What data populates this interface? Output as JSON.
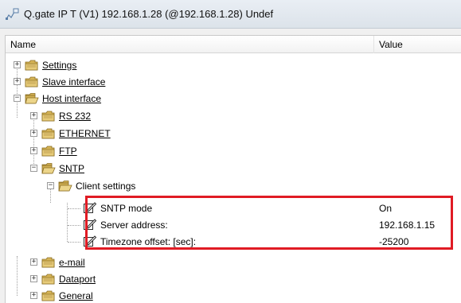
{
  "window": {
    "title": "Q.gate IP T (V1) 192.168.1.28 (@192.168.1.28) Undef"
  },
  "header": {
    "name": "Name",
    "value": "Value"
  },
  "tree": {
    "settings": "Settings",
    "slave_interface": "Slave interface",
    "host_interface": "Host interface",
    "rs232": "RS 232",
    "ethernet": "ETHERNET",
    "ftp": "FTP",
    "sntp": "SNTP",
    "client_settings": "Client settings",
    "sntp_mode": {
      "label": "SNTP mode",
      "value": "On"
    },
    "server_address": {
      "label": "Server address:",
      "value": "192.168.1.15"
    },
    "timezone_offset": {
      "label": "Timezone offset: [sec]:",
      "value": "-25200"
    },
    "email": "e-mail",
    "dataport": "Dataport",
    "general": "General"
  },
  "icons": {
    "app": "network-icon",
    "folder": "folder-icon",
    "edit": "edit-icon"
  },
  "colors": {
    "highlight": "#e01b24",
    "folder": "#c9a64a"
  }
}
